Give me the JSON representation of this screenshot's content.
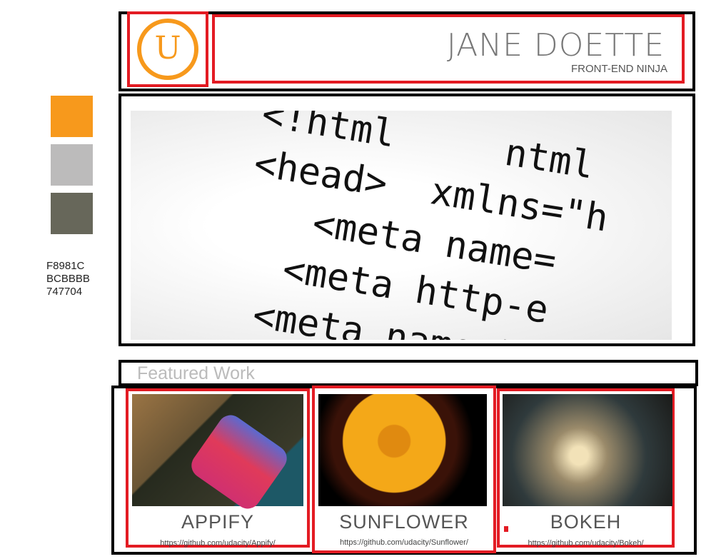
{
  "palette": {
    "colors": [
      "#F8981C",
      "#BCBBBB",
      "#747704"
    ],
    "labels": [
      "F8981C",
      "BCBBBB",
      "747704"
    ],
    "swatch_display": [
      "#f7991c",
      "#bcbbbb",
      "#67675a"
    ]
  },
  "header": {
    "logo_letter": "U",
    "name": "JANE DOETTE",
    "role": "FRONT-END NINJA"
  },
  "hero": {
    "code": "<!html     ntml\n<head>  xmlns=\"h\n   <meta name=\n  <meta http-e\n <meta name=\"\n<meta"
  },
  "featured": {
    "heading": "Featured Work",
    "items": [
      {
        "title": "APPIFY",
        "url": "https://github.com/udacity/Appify/"
      },
      {
        "title": "SUNFLOWER",
        "url": "https://github.com/udacity/Sunflower/"
      },
      {
        "title": "BOKEH",
        "url": "https://github.com/udacity/Bokeh/"
      }
    ]
  }
}
